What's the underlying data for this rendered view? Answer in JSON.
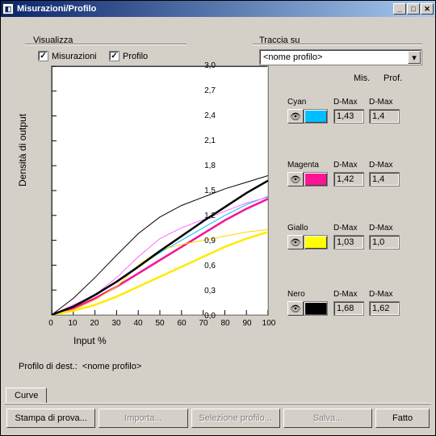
{
  "window": {
    "title": "Misurazioni/Profilo"
  },
  "visualizza": {
    "label": "Visualizza",
    "misurazioni_label": "Misurazioni",
    "profilo_label": "Profilo",
    "misurazioni_checked": true,
    "profilo_checked": true
  },
  "traccia_su": {
    "label": "Traccia su",
    "selected": "<nome profilo>"
  },
  "legend_headers": {
    "mis": "Mis.",
    "prof": "Prof."
  },
  "inks": [
    {
      "name": "Cyan",
      "color": "#00bfff",
      "dmax1_label": "D-Max",
      "dmax1": "1,43",
      "dmax2_label": "D-Max",
      "dmax2": "1,4"
    },
    {
      "name": "Magenta",
      "color": "#ff1493",
      "dmax1_label": "D-Max",
      "dmax1": "1,42",
      "dmax2_label": "D-Max",
      "dmax2": "1,4"
    },
    {
      "name": "Giallo",
      "color": "#ffff00",
      "dmax1_label": "D-Max",
      "dmax1": "1,03",
      "dmax2_label": "D-Max",
      "dmax2": "1,0"
    },
    {
      "name": "Nero",
      "color": "#000000",
      "dmax1_label": "D-Max",
      "dmax1": "1,68",
      "dmax2_label": "D-Max",
      "dmax2": "1,62"
    }
  ],
  "chart_data": {
    "type": "line",
    "xlabel": "Input %",
    "ylabel": "Densità di output",
    "xlim": [
      0,
      100
    ],
    "ylim": [
      0,
      3.0
    ],
    "xticks": [
      0,
      10,
      20,
      30,
      40,
      50,
      60,
      70,
      80,
      90,
      100
    ],
    "yticks": [
      0.0,
      0.3,
      0.6,
      0.9,
      1.2,
      1.5,
      1.8,
      2.1,
      2.4,
      2.7,
      3.0
    ],
    "x": [
      0,
      10,
      20,
      30,
      40,
      50,
      60,
      70,
      80,
      90,
      100
    ],
    "series": [
      {
        "name": "Cyan-Mis",
        "color": "#00bfff",
        "thin": true,
        "values": [
          0,
          0.1,
          0.25,
          0.4,
          0.58,
          0.75,
          0.9,
          1.05,
          1.2,
          1.33,
          1.43
        ]
      },
      {
        "name": "Cyan-Prof",
        "color": "#00bfff",
        "thin": false,
        "values": [
          0,
          0.08,
          0.2,
          0.34,
          0.5,
          0.66,
          0.82,
          0.98,
          1.14,
          1.28,
          1.4
        ]
      },
      {
        "name": "Magenta-Mis",
        "color": "#ff66ff",
        "thin": true,
        "values": [
          0,
          0.12,
          0.24,
          0.45,
          0.7,
          0.92,
          1.05,
          1.15,
          1.25,
          1.35,
          1.42
        ]
      },
      {
        "name": "Magenta-Prof",
        "color": "#ff1493",
        "thin": false,
        "values": [
          0,
          0.08,
          0.2,
          0.34,
          0.5,
          0.66,
          0.82,
          0.98,
          1.14,
          1.28,
          1.4
        ]
      },
      {
        "name": "Giallo-Mis",
        "color": "#ffd700",
        "thin": true,
        "values": [
          0,
          0.06,
          0.18,
          0.34,
          0.6,
          0.78,
          0.85,
          0.9,
          0.95,
          1.0,
          1.03
        ]
      },
      {
        "name": "Giallo-Prof",
        "color": "#ffea00",
        "thin": false,
        "values": [
          0,
          0.05,
          0.12,
          0.22,
          0.34,
          0.46,
          0.58,
          0.7,
          0.82,
          0.92,
          1.0
        ]
      },
      {
        "name": "Nero-Mis",
        "color": "#000000",
        "thin": true,
        "values": [
          0,
          0.2,
          0.45,
          0.72,
          0.98,
          1.18,
          1.32,
          1.42,
          1.52,
          1.6,
          1.68
        ]
      },
      {
        "name": "Nero-Prof",
        "color": "#000000",
        "thin": false,
        "values": [
          0,
          0.1,
          0.24,
          0.4,
          0.58,
          0.77,
          0.95,
          1.13,
          1.3,
          1.47,
          1.62
        ]
      }
    ]
  },
  "dest": {
    "label": "Profilo di dest.:",
    "value": "<nome profilo>"
  },
  "tabs": {
    "curve": "Curve"
  },
  "buttons": {
    "stampa": "Stampa di prova...",
    "importa": "Importa...",
    "selezione": "Selezione profilo...",
    "salva": "Salva...",
    "fatto": "Fatto"
  }
}
